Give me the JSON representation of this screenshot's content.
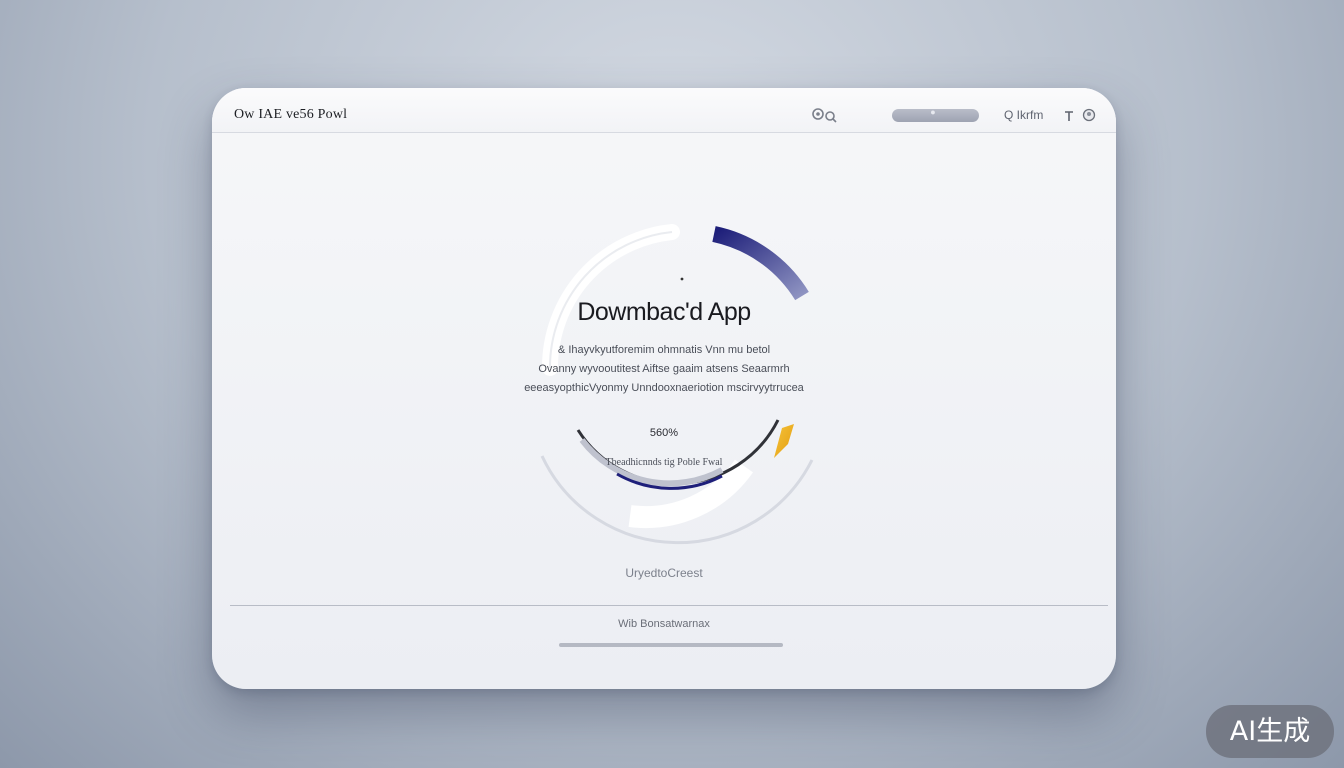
{
  "window": {
    "title": "Ow IAE ve56 Powl",
    "search_label": "Q Ikrfm",
    "icons": [
      "settings-icon",
      "search-icon",
      "menu-icon",
      "user-icon"
    ]
  },
  "main": {
    "heading": "Dowmbac'd App",
    "description": [
      "& Ihayvkyutforemim ohmnatis Vnn mu betol",
      "Ovanny wyvooutitest Aiftse gaaim atsens Seaarmrh",
      "eeeasyopthicVyonmy Unndooxnaeriotion mscirvyytrrucea"
    ],
    "progress_percent_text": "560%",
    "status_text": "Tbeadhicnnds tig Poble Fwal",
    "link_text": "UryedtoCreest"
  },
  "footer": {
    "text": "Wib Bonsatwarnax"
  },
  "colors": {
    "accent_navy": "#1e1f7a",
    "accent_gold": "#f0b21a",
    "window_bg": "#f3f4f7"
  },
  "badge": {
    "label": "AI生成"
  }
}
